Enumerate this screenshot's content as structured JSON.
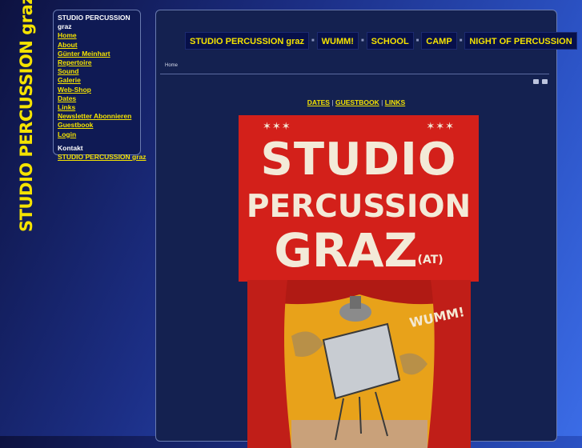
{
  "logo": {
    "text": "STUDIO PERCUSSION graz"
  },
  "sidebar": {
    "heading": "STUDIO PERCUSSION graz",
    "items": [
      {
        "label": "Home"
      },
      {
        "label": "About"
      },
      {
        "label": "Günter Meinhart"
      },
      {
        "label": "Repertoire"
      },
      {
        "label": "Sound"
      },
      {
        "label": "Galerie"
      },
      {
        "label": "Web-Shop"
      },
      {
        "label": "Dates"
      },
      {
        "label": "Links"
      },
      {
        "label": "Newsletter Abonnieren"
      },
      {
        "label": "Guestbook"
      },
      {
        "label": "Login"
      }
    ],
    "contact_heading": "Kontakt",
    "contact_link": "STUDIO PERCUSSION graz"
  },
  "topnav": {
    "items": [
      {
        "label": "STUDIO PERCUSSION graz"
      },
      {
        "label": "WUMM!"
      },
      {
        "label": "SCHOOL"
      },
      {
        "label": "CAMP"
      },
      {
        "label": "NIGHT OF PERCUSSION"
      }
    ]
  },
  "breadcrumb": "Home",
  "quicklinks": {
    "dates": "DATES",
    "guestbook": "GUESTBOOK",
    "links": "LINKS",
    "separator": "|"
  },
  "poster": {
    "line1": "STUDIO",
    "line2": "PERCUSSION",
    "line3": "GRAZ",
    "country": "(AT)",
    "wumm": "WUMM!"
  },
  "colors": {
    "accent": "#f5e300",
    "panel": "#142150",
    "poster_red": "#d3201a"
  }
}
